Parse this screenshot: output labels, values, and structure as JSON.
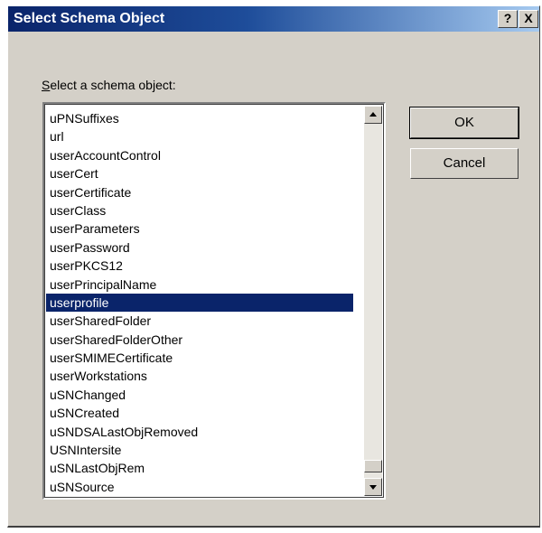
{
  "window": {
    "title": "Select Schema Object",
    "help_label": "?",
    "close_label": "X"
  },
  "prompt": {
    "accel": "S",
    "rest": "elect a schema object:"
  },
  "list": {
    "items": [
      "uPNSuffixes",
      "url",
      "userAccountControl",
      "userCert",
      "userCertificate",
      "userClass",
      "userParameters",
      "userPassword",
      "userPKCS12",
      "userPrincipalName",
      "userprofile",
      "userSharedFolder",
      "userSharedFolderOther",
      "userSMIMECertificate",
      "userWorkstations",
      "uSNChanged",
      "uSNCreated",
      "uSNDSALastObjRemoved",
      "USNIntersite",
      "uSNLastObjRem",
      "uSNSource"
    ],
    "selected_item": "userprofile"
  },
  "buttons": {
    "ok_label": "OK",
    "cancel_label": "Cancel"
  },
  "colors": {
    "title_bar": "#0a246a",
    "selection": "#0a246a",
    "dialog_face": "#d4d0c8"
  }
}
